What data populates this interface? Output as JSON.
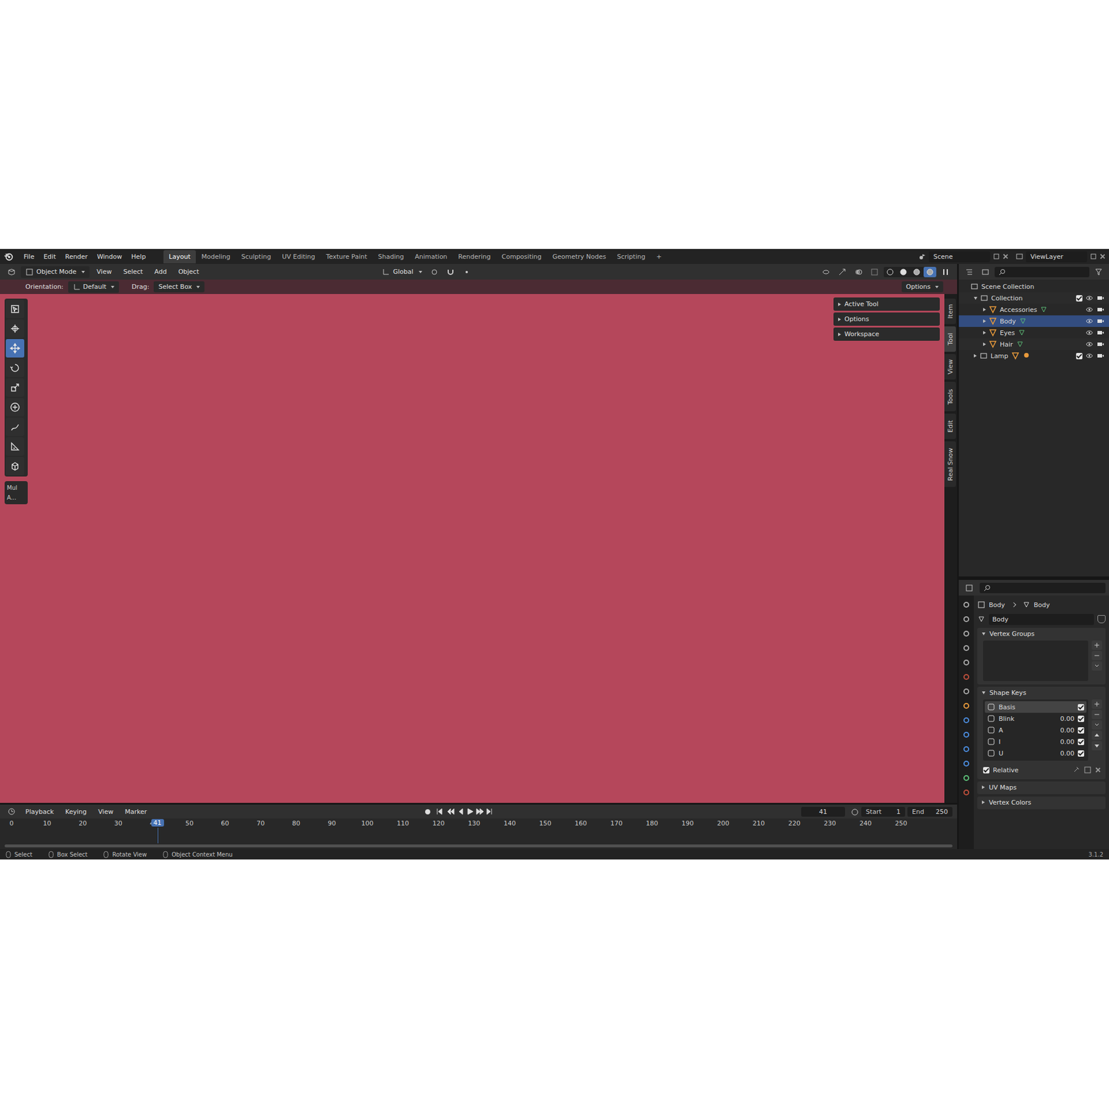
{
  "window": {
    "title": "Blender",
    "version": "3.1.2"
  },
  "menu": [
    "File",
    "Edit",
    "Render",
    "Window",
    "Help"
  ],
  "workspaces": [
    {
      "label": "Layout",
      "selected": true
    },
    {
      "label": "Modeling",
      "selected": false
    },
    {
      "label": "Sculpting",
      "selected": false
    },
    {
      "label": "UV Editing",
      "selected": false
    },
    {
      "label": "Texture Paint",
      "selected": false
    },
    {
      "label": "Shading",
      "selected": false
    },
    {
      "label": "Animation",
      "selected": false
    },
    {
      "label": "Rendering",
      "selected": false
    },
    {
      "label": "Compositing",
      "selected": false
    },
    {
      "label": "Geometry Nodes",
      "selected": false
    },
    {
      "label": "Scripting",
      "selected": false
    }
  ],
  "add_workspace": "+",
  "scene": "Scene",
  "view_layer": "ViewLayer",
  "viewport_header": {
    "mode": "Object Mode",
    "menus": [
      "View",
      "Select",
      "Add",
      "Object"
    ],
    "orientation": "Global",
    "options": "Options",
    "shading": [
      {
        "selected": false
      },
      {
        "selected": false
      },
      {
        "selected": false
      },
      {
        "selected": true
      }
    ]
  },
  "tool_settings": {
    "orientation_label": "Orientation:",
    "orientation": "Default",
    "drag_label": "Drag:",
    "drag": "Select Box"
  },
  "toolbar": {
    "tools": [
      {
        "selected": false
      },
      {
        "selected": false
      },
      {
        "selected": true
      },
      {
        "selected": false
      },
      {
        "selected": false
      },
      {
        "selected": false
      },
      {
        "selected": false
      },
      {
        "selected": false
      },
      {
        "selected": false
      }
    ],
    "panel": [
      "Mul",
      "A..."
    ]
  },
  "n_panel": [
    {
      "label": "Active Tool",
      "expanded": false
    },
    {
      "label": "Options",
      "expanded": false
    },
    {
      "label": "Workspace",
      "expanded": false
    }
  ],
  "sidebar_tabs": [
    {
      "label": "Item",
      "selected": false
    },
    {
      "label": "Tool",
      "selected": true
    },
    {
      "label": "View",
      "selected": false
    },
    {
      "label": "Tools",
      "selected": false
    },
    {
      "label": "Edit",
      "selected": false
    },
    {
      "label": "Real Snow",
      "selected": false
    }
  ],
  "outliner": {
    "root": "Scene Collection",
    "collection": {
      "label": "Collection",
      "expanded": true,
      "checked": true
    },
    "objects": [
      {
        "label": "Accessories",
        "expanded": false,
        "selected": false
      },
      {
        "label": "Body",
        "expanded": false,
        "selected": true
      },
      {
        "label": "Eyes",
        "expanded": false,
        "selected": false
      },
      {
        "label": "Hair",
        "expanded": false,
        "selected": false
      }
    ],
    "lamp": {
      "label": "Lamp",
      "expanded": false,
      "checked": true
    }
  },
  "properties": {
    "breadcrumb": [
      "Body",
      "Body"
    ],
    "data_name": "Body",
    "vertex_groups": {
      "title": "Vertex Groups",
      "expanded": true
    },
    "shape_keys": {
      "title": "Shape Keys",
      "expanded": true,
      "keys": [
        {
          "name": "Basis",
          "value": "",
          "checked": true,
          "selected": true
        },
        {
          "name": "Blink",
          "value": "0.00",
          "checked": true,
          "selected": false
        },
        {
          "name": "A",
          "value": "0.00",
          "checked": true,
          "selected": false
        },
        {
          "name": "I",
          "value": "0.00",
          "checked": true,
          "selected": false
        },
        {
          "name": "U",
          "value": "0.00",
          "checked": true,
          "selected": false
        }
      ],
      "relative": {
        "label": "Relative",
        "checked": true
      }
    },
    "collapsed_panels": [
      {
        "title": "UV Maps",
        "expanded": false
      },
      {
        "title": "Vertex Colors",
        "expanded": false
      }
    ]
  },
  "timeline": {
    "menus": [
      "Playback",
      "Keying",
      "View",
      "Marker"
    ],
    "current": "41",
    "start_label": "Start",
    "start": "1",
    "end_label": "End",
    "end": "250",
    "ticks": [
      "0",
      "10",
      "20",
      "30",
      "40",
      "50",
      "60",
      "70",
      "80",
      "90",
      "100",
      "110",
      "120",
      "130",
      "140",
      "150",
      "160",
      "170",
      "180",
      "190",
      "200",
      "210",
      "220",
      "230",
      "240",
      "250"
    ]
  },
  "status_bar": [
    "Select",
    "Box Select",
    "Rotate View",
    "Object Context Menu"
  ]
}
